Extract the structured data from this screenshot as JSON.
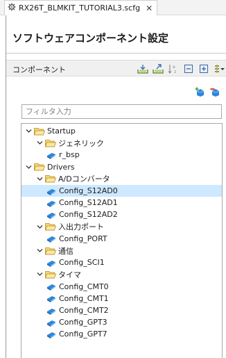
{
  "tab": {
    "filename": "RX26T_BLMKIT_TUTORIAL3.scfg",
    "close_glyph": "✕",
    "icon": "gear-icon"
  },
  "editor": {
    "title": "ソフトウェアコンポーネント設定"
  },
  "components": {
    "label": "コンポーネント",
    "toolbar_icons": [
      "import-icon",
      "export-icon",
      "sort-icon",
      "collapse-all-icon",
      "expand-all-icon",
      "view-menu-icon"
    ],
    "add_icons": [
      "add-component-icon",
      "remove-component-icon"
    ]
  },
  "filter": {
    "placeholder": "フィルタ入力",
    "value": ""
  },
  "tree": {
    "nodes": [
      {
        "label": "Startup",
        "kind": "folder",
        "level": 0,
        "expanded": true
      },
      {
        "label": "ジェネリック",
        "kind": "folder",
        "level": 1,
        "expanded": true
      },
      {
        "label": "r_bsp",
        "kind": "component",
        "level": 2
      },
      {
        "label": "Drivers",
        "kind": "folder",
        "level": 0,
        "expanded": true
      },
      {
        "label": "A/Dコンバータ",
        "kind": "folder",
        "level": 1,
        "expanded": true
      },
      {
        "label": "Config_S12AD0",
        "kind": "component",
        "level": 2,
        "selected": true
      },
      {
        "label": "Config_S12AD1",
        "kind": "component",
        "level": 2
      },
      {
        "label": "Config_S12AD2",
        "kind": "component",
        "level": 2
      },
      {
        "label": "入出力ポート",
        "kind": "folder",
        "level": 1,
        "expanded": true
      },
      {
        "label": "Config_PORT",
        "kind": "component",
        "level": 2
      },
      {
        "label": "通信",
        "kind": "folder",
        "level": 1,
        "expanded": true
      },
      {
        "label": "Config_SCI1",
        "kind": "component",
        "level": 2
      },
      {
        "label": "タイマ",
        "kind": "folder",
        "level": 1,
        "expanded": true
      },
      {
        "label": "Config_CMT0",
        "kind": "component",
        "level": 2
      },
      {
        "label": "Config_CMT1",
        "kind": "component",
        "level": 2
      },
      {
        "label": "Config_CMT2",
        "kind": "component",
        "level": 2
      },
      {
        "label": "Config_GPT3",
        "kind": "component",
        "level": 2
      },
      {
        "label": "Config_GPT7",
        "kind": "component",
        "level": 2
      }
    ]
  },
  "colors": {
    "selection": "#cde8ff",
    "folder": "#f1c453",
    "component": "#2f86d8"
  }
}
